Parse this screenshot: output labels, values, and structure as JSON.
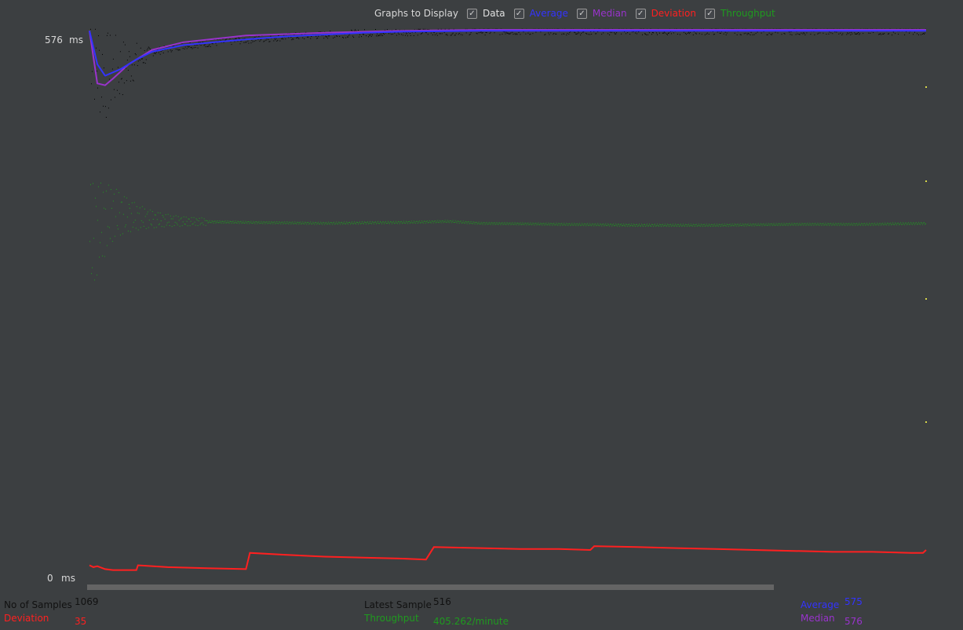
{
  "legend": {
    "title": "Graphs to Display",
    "items": [
      {
        "label": "Data",
        "color": "#e0e0e0",
        "checked": true
      },
      {
        "label": "Average",
        "color": "#3333ff",
        "checked": true
      },
      {
        "label": "Median",
        "color": "#9933cc",
        "checked": true
      },
      {
        "label": "Deviation",
        "color": "#ff2020",
        "checked": true
      },
      {
        "label": "Throughput",
        "color": "#1f9a1f",
        "checked": true
      }
    ]
  },
  "axis": {
    "max_value": "576",
    "max_unit": "ms",
    "min_value": "0",
    "min_unit": "ms"
  },
  "stats": {
    "samples_label": "No of Samples",
    "samples_value": "1069",
    "latest_label": "Latest Sample",
    "latest_value": "516",
    "average_label": "Average",
    "average_value": "575",
    "deviation_label": "Deviation",
    "deviation_value": "35",
    "throughput_label": "Throughput",
    "throughput_value": "405.262/minute",
    "median_label": "Median",
    "median_value": "576"
  },
  "colors": {
    "background": "#3c3f41",
    "data": "#000000",
    "average": "#3333ff",
    "median": "#9933cc",
    "deviation": "#ff2020",
    "throughput": "#1f9a1f",
    "text": "#d8d8d8"
  },
  "chart_data": {
    "type": "line",
    "x_label": "",
    "y_label": "",
    "ylim": [
      0,
      576
    ],
    "sample_count": 1069,
    "series": [
      {
        "name": "Average",
        "x": [
          0,
          10,
          20,
          40,
          60,
          80,
          120,
          160,
          200,
          250,
          300,
          350,
          400,
          500,
          600,
          700,
          800,
          900,
          1000,
          1069
        ],
        "y": [
          575,
          540,
          528,
          535,
          545,
          553,
          560,
          563,
          566,
          569,
          571,
          573,
          574,
          575,
          575,
          575,
          575,
          575,
          575,
          575
        ]
      },
      {
        "name": "Median",
        "x": [
          0,
          10,
          20,
          30,
          50,
          80,
          120,
          200,
          300,
          400,
          500,
          600,
          700,
          800,
          900,
          1000,
          1069
        ],
        "y": [
          575,
          520,
          518,
          525,
          540,
          555,
          563,
          570,
          573,
          575,
          576,
          576,
          576,
          576,
          576,
          576,
          576
        ]
      },
      {
        "name": "Deviation",
        "x": [
          0,
          5,
          10,
          20,
          30,
          40,
          60,
          62,
          100,
          150,
          200,
          205,
          250,
          300,
          350,
          400,
          430,
          440,
          500,
          550,
          600,
          640,
          645,
          700,
          750,
          800,
          850,
          900,
          950,
          1000,
          1050,
          1065,
          1069
        ],
        "y": [
          16,
          14,
          15,
          12,
          11,
          11,
          11,
          16,
          14,
          13,
          12,
          29,
          27,
          25,
          24,
          23,
          22,
          35,
          34,
          33,
          33,
          32,
          36,
          35,
          34,
          33,
          32,
          31,
          30,
          30,
          29,
          29,
          32
        ]
      },
      {
        "name": "Throughput",
        "x": [
          0,
          10,
          20,
          30,
          50,
          80,
          120,
          200,
          300,
          400,
          460,
          500,
          600,
          700,
          800,
          900,
          1000,
          1069
        ],
        "y": [
          355,
          370,
          378,
          385,
          382,
          378,
          376,
          375,
          374,
          375,
          376,
          374,
          373,
          372,
          372,
          373,
          373,
          374
        ]
      }
    ],
    "data_points": {
      "name": "Data",
      "latest": 516
    }
  }
}
